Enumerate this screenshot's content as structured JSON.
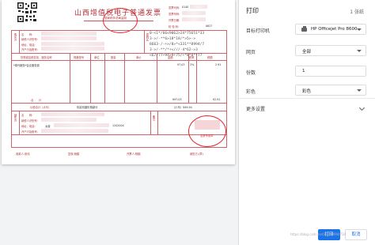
{
  "invoice": {
    "title": "山西增值税电子普通发票",
    "subtitle": "国家税务总局监制",
    "header_labels": [
      "发票代码:",
      "发票号码:",
      "开票日期:",
      "校 验 码:"
    ],
    "header_values": [
      "0140",
      "",
      "",
      "0627"
    ],
    "buyer_labels": [
      "名　　称:",
      "纳税人识别号:",
      "地址、电话:",
      "开户行及账号:"
    ],
    "buyer_values": [
      "",
      "",
      "",
      ""
    ],
    "buyer_side": "购买方",
    "password_area": "密码区",
    "password_lines": [
      "0-<1*/66<9062>24*75651*33",
      "3->/-**6>18*18/*>5>->",
      "8663-/-+>/8>*<331**8994/7",
      "3->/-**/*+<///-4*62->3",
      "<67/77+94>9+75/+*8*8**77"
    ],
    "table_headers": [
      "货物或应税劳务、服务名称",
      "规格型号",
      "单位",
      "数量",
      "单价",
      "金额",
      "税率",
      "税额"
    ],
    "item_name": "*现代服务*会议服务费",
    "item_amount": "97.03",
    "item_tax_rate": "3%",
    "item_tax": "2.91",
    "total_label": "合　　计",
    "total_amount": "¥97.03",
    "total_tax": "¥2.91",
    "tax_total_label": "价税合计（大写）",
    "tax_total_words": "玖拾玖圆玖角肆分",
    "tax_total_small": "（小写）¥99.94",
    "seller_side": "销售方",
    "seller_labels": [
      "名　　称:",
      "纳税人识别号:",
      "地址、电话:",
      "开户行及账号:"
    ],
    "seller_values": [
      "",
      "",
      "太原",
      ""
    ],
    "remarks_label": "备注",
    "remarks_value": "1202004",
    "footer": [
      "收款人:张伟",
      "复核:杨鹤",
      "开票人:杨鹤",
      "销售方:(章)"
    ],
    "stamp_text": "发票专用章"
  },
  "panel": {
    "title": "打印",
    "sheet_count": "1 张纸",
    "rows": [
      {
        "label": "目标打印机",
        "value": "HP Officejet Pro 8600",
        "icon": "printer-icon"
      },
      {
        "label": "网页",
        "value": "全部"
      },
      {
        "label": "份数",
        "value": "1"
      },
      {
        "label": "彩色",
        "value": "彩色"
      }
    ],
    "more_settings": "更多设置",
    "print_button": "打印",
    "cancel_button": "取消"
  },
  "watermark": "https://blog.csdn.net/qq_40994734",
  "colors": {
    "accent": "#1a73e8",
    "invoice_red": "#b4303a",
    "annotation_red": "#e0262b"
  }
}
